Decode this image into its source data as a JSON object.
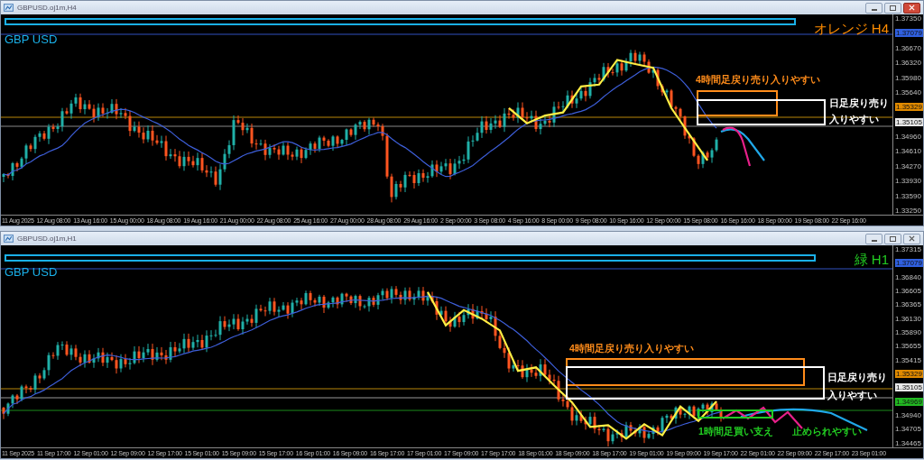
{
  "windows": [
    {
      "title": "GBPUSD.oj1m,H4",
      "symbol": "GBP USD",
      "label": {
        "text": "オレンジ H4",
        "color": "#ff8c00"
      },
      "annotations": [
        {
          "lines": [
            "4時間足戻り売り入りやすい"
          ],
          "color": "#ff8c1a"
        },
        {
          "lines": [
            "日足戻り売り",
            "入りやすい"
          ],
          "color": "#ffffff"
        }
      ],
      "price_axis": [
        {
          "kind": "tick",
          "text": "1.37350"
        },
        {
          "kind": "tag",
          "text": "1.37079",
          "color": "#3060e0"
        },
        {
          "kind": "tick",
          "text": "1.36670"
        },
        {
          "kind": "tick",
          "text": "1.36320"
        },
        {
          "kind": "tick",
          "text": "1.35980"
        },
        {
          "kind": "tick",
          "text": "1.35640"
        },
        {
          "kind": "tag",
          "text": "1.35329",
          "color": "#e08a00"
        },
        {
          "kind": "tag",
          "text": "1.35105",
          "color": "#e8e8e8"
        },
        {
          "kind": "tick",
          "text": "1.34960"
        },
        {
          "kind": "tick",
          "text": "1.34610"
        },
        {
          "kind": "tick",
          "text": "1.34270"
        },
        {
          "kind": "tick",
          "text": "1.33930"
        },
        {
          "kind": "tick",
          "text": "1.33590"
        },
        {
          "kind": "tick",
          "text": "1.33250"
        }
      ],
      "time_axis": [
        "11 Aug 2025",
        "12 Aug 08:00",
        "13 Aug 16:00",
        "15 Aug 00:00",
        "18 Aug 08:00",
        "19 Aug 16:00",
        "21 Aug 00:00",
        "22 Aug 08:00",
        "25 Aug 16:00",
        "27 Aug 00:00",
        "28 Aug 08:00",
        "29 Aug 16:00",
        "2 Sep 00:00",
        "3 Sep 08:00",
        "4 Sep 16:00",
        "8 Sep 00:00",
        "9 Sep 08:00",
        "10 Sep 16:00",
        "12 Sep 00:00",
        "15 Sep 08:00",
        "16 Sep 16:00",
        "18 Sep 00:00",
        "19 Sep 08:00",
        "22 Sep 16:00"
      ]
    },
    {
      "title": "GBPUSD.oj1m,H1",
      "symbol": "GBP USD",
      "label": {
        "text": "緑 H1",
        "color": "#22cc22"
      },
      "annotations": [
        {
          "lines": [
            "4時間足戻り売り入りやすい"
          ],
          "color": "#ff8c1a"
        },
        {
          "lines": [
            "日足戻り売り",
            "入りやすい"
          ],
          "color": "#ffffff"
        },
        {
          "lines": [
            "1時間足買い支え"
          ],
          "color": "#22cc22"
        },
        {
          "lines": [
            "止められやすい"
          ],
          "color": "#22cc22"
        }
      ],
      "price_axis": [
        {
          "kind": "tick",
          "text": "1.37315"
        },
        {
          "kind": "tag",
          "text": "1.37079",
          "color": "#3060e0"
        },
        {
          "kind": "tick",
          "text": "1.36840"
        },
        {
          "kind": "tick",
          "text": "1.36605"
        },
        {
          "kind": "tick",
          "text": "1.36365"
        },
        {
          "kind": "tick",
          "text": "1.36130"
        },
        {
          "kind": "tick",
          "text": "1.35890"
        },
        {
          "kind": "tick",
          "text": "1.35655"
        },
        {
          "kind": "tick",
          "text": "1.35415"
        },
        {
          "kind": "tag",
          "text": "1.35329",
          "color": "#e08a00"
        },
        {
          "kind": "tag",
          "text": "1.35105",
          "color": "#e8e8e8"
        },
        {
          "kind": "tag",
          "text": "1.34969",
          "color": "#22b822"
        },
        {
          "kind": "tick",
          "text": "1.34940"
        },
        {
          "kind": "tick",
          "text": "1.34705"
        },
        {
          "kind": "tick",
          "text": "1.34465"
        }
      ],
      "time_axis": [
        "11 Sep 2025",
        "11 Sep 17:00",
        "12 Sep 01:00",
        "12 Sep 09:00",
        "12 Sep 17:00",
        "15 Sep 01:00",
        "15 Sep 09:00",
        "15 Sep 17:00",
        "16 Sep 01:00",
        "16 Sep 09:00",
        "16 Sep 17:00",
        "17 Sep 01:00",
        "17 Sep 09:00",
        "17 Sep 17:00",
        "18 Sep 01:00",
        "18 Sep 09:00",
        "18 Sep 17:00",
        "19 Sep 01:00",
        "19 Sep 09:00",
        "19 Sep 17:00",
        "22 Sep 01:00",
        "22 Sep 09:00",
        "22 Sep 17:00",
        "23 Sep 01:00"
      ]
    }
  ]
}
